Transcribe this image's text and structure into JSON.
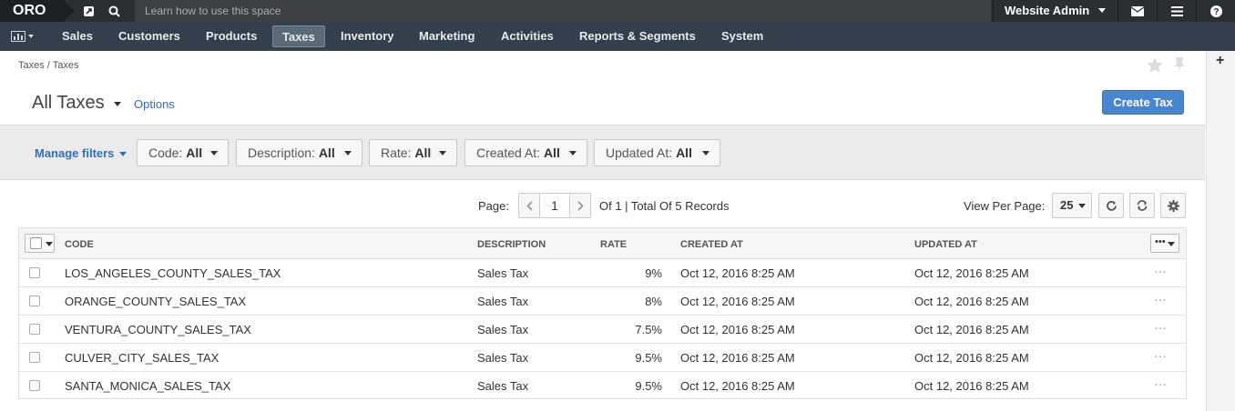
{
  "topbar": {
    "logo": "ORO",
    "search_hint": "Learn how to use this space",
    "user": "Website Admin"
  },
  "nav": {
    "items": [
      {
        "label": "Sales"
      },
      {
        "label": "Customers"
      },
      {
        "label": "Products"
      },
      {
        "label": "Taxes",
        "active": true
      },
      {
        "label": "Inventory"
      },
      {
        "label": "Marketing"
      },
      {
        "label": "Activities"
      },
      {
        "label": "Reports & Segments"
      },
      {
        "label": "System"
      }
    ]
  },
  "breadcrumb": "Taxes / Taxes",
  "page": {
    "title": "All Taxes",
    "options": "Options",
    "create_button": "Create Tax"
  },
  "filters": {
    "manage": "Manage filters",
    "items": [
      {
        "name": "Code:",
        "value": "All"
      },
      {
        "name": "Description:",
        "value": "All"
      },
      {
        "name": "Rate:",
        "value": "All"
      },
      {
        "name": "Created At:",
        "value": "All"
      },
      {
        "name": "Updated At:",
        "value": "All"
      }
    ]
  },
  "pager": {
    "label": "Page:",
    "current": "1",
    "total_text": "Of 1 | Total Of 5 Records",
    "view_per_page_label": "View Per Page:",
    "view_per_page": "25"
  },
  "grid": {
    "columns": [
      "CODE",
      "DESCRIPTION",
      "RATE",
      "CREATED AT",
      "UPDATED AT"
    ],
    "rows": [
      {
        "code": "LOS_ANGELES_COUNTY_SALES_TAX",
        "description": "Sales Tax",
        "rate": "9%",
        "created": "Oct 12, 2016 8:25 AM",
        "updated": "Oct 12, 2016 8:25 AM"
      },
      {
        "code": "ORANGE_COUNTY_SALES_TAX",
        "description": "Sales Tax",
        "rate": "8%",
        "created": "Oct 12, 2016 8:25 AM",
        "updated": "Oct 12, 2016 8:25 AM"
      },
      {
        "code": "VENTURA_COUNTY_SALES_TAX",
        "description": "Sales Tax",
        "rate": "7.5%",
        "created": "Oct 12, 2016 8:25 AM",
        "updated": "Oct 12, 2016 8:25 AM"
      },
      {
        "code": "CULVER_CITY_SALES_TAX",
        "description": "Sales Tax",
        "rate": "9.5%",
        "created": "Oct 12, 2016 8:25 AM",
        "updated": "Oct 12, 2016 8:25 AM"
      },
      {
        "code": "SANTA_MONICA_SALES_TAX",
        "description": "Sales Tax",
        "rate": "9.5%",
        "created": "Oct 12, 2016 8:25 AM",
        "updated": "Oct 12, 2016 8:25 AM"
      }
    ],
    "row_action": "···"
  },
  "colors": {
    "topbar": "#2b2f33",
    "nav": "#33404c",
    "primary": "#4a86cf",
    "link": "#2f6fbf"
  }
}
